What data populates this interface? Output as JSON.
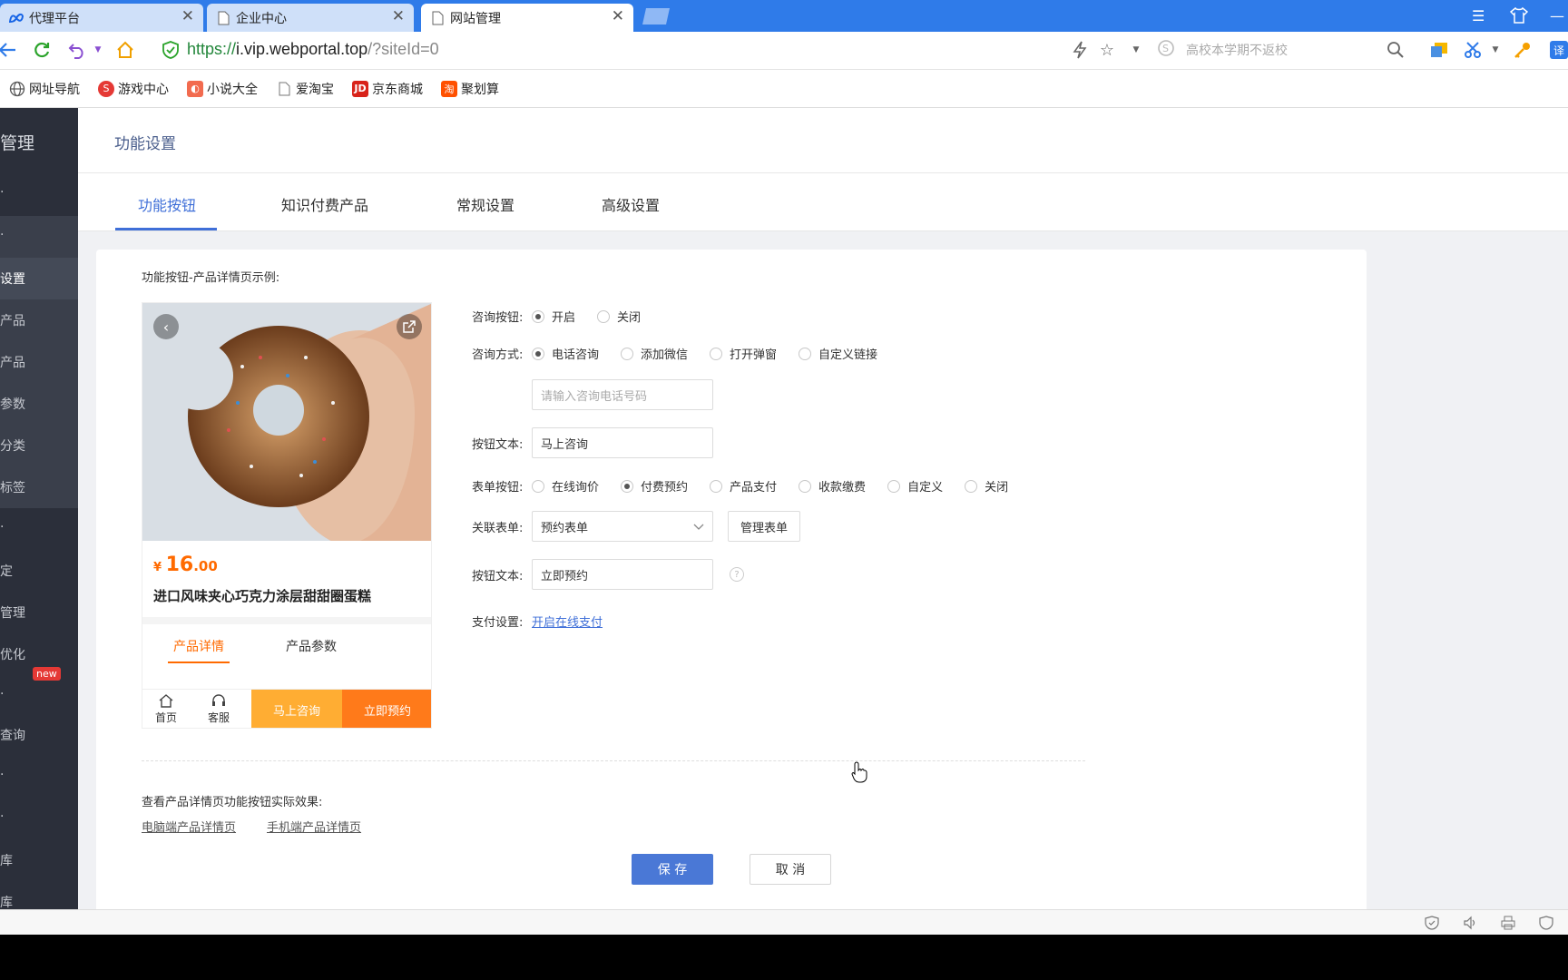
{
  "browser": {
    "tabs": [
      {
        "label": "代理平台",
        "icon": "meta-logo-icon"
      },
      {
        "label": "企业中心",
        "icon": "page-icon"
      },
      {
        "label": "网站管理",
        "icon": "page-icon"
      }
    ],
    "url_proto": "https://",
    "url_host": "i.vip.webportal.top",
    "url_path": "/?siteId=0",
    "search_placeholder": "高校本学期不返校",
    "bookmarks": [
      {
        "label": "网址导航",
        "icon": "globe-icon"
      },
      {
        "label": "游戏中心",
        "icon": "game-icon"
      },
      {
        "label": "小说大全",
        "icon": "book-icon"
      },
      {
        "label": "爱淘宝",
        "icon": "page-icon"
      },
      {
        "label": "京东商城",
        "icon": "jd-icon",
        "badge": "JD"
      },
      {
        "label": "聚划算",
        "icon": "taobao-icon",
        "badge": "淘"
      }
    ]
  },
  "sidebar": {
    "title": "管理",
    "items": [
      "·",
      "·",
      "设置",
      "产品",
      "产品",
      "参数",
      "分类",
      "标签",
      "·",
      "定",
      "管理",
      "优化",
      "·",
      "查询",
      "·",
      "·",
      "库",
      "库"
    ],
    "new_badge": "new"
  },
  "header": {
    "title": "功能设置"
  },
  "tabs": [
    "功能按钮",
    "知识付费产品",
    "常规设置",
    "高级设置"
  ],
  "card": {
    "sample_title": "功能按钮-产品详情页示例:",
    "preview": {
      "currency": "¥",
      "price_int": "16",
      "price_dec": ".00",
      "name": "进口风味夹心巧克力涂层甜甜圈蛋糕",
      "tab_detail": "产品详情",
      "tab_params": "产品参数",
      "home_label": "首页",
      "service_label": "客服",
      "consult_label": "马上咨询",
      "book_label": "立即预约"
    },
    "form": {
      "consult_button_label": "咨询按钮:",
      "consult_on": "开启",
      "consult_off": "关闭",
      "consult_method_label": "咨询方式:",
      "methods": [
        "电话咨询",
        "添加微信",
        "打开弹窗",
        "自定义链接"
      ],
      "phone_placeholder": "请输入咨询电话号码",
      "button_text_label": "按钮文本:",
      "button_text_value": "马上咨询",
      "form_button_label": "表单按钮:",
      "form_options": [
        "在线询价",
        "付费预约",
        "产品支付",
        "收款缴费",
        "自定义",
        "关闭"
      ],
      "linked_form_label": "关联表单:",
      "linked_form_value": "预约表单",
      "manage_form": "管理表单",
      "button_text2_label": "按钮文本:",
      "button_text2_value": "立即预约",
      "help_mark": "?",
      "pay_label": "支付设置:",
      "pay_link": "开启在线支付"
    },
    "effect_title": "查看产品详情页功能按钮实际效果:",
    "effect_links": [
      "电脑端产品详情页",
      "手机端产品详情页"
    ],
    "save": "保 存",
    "cancel": "取 消"
  },
  "colors": {
    "browser_blue": "#2f7be9",
    "accent": "#3f6fd8",
    "orange": "#ff7a1a",
    "sidebar": "#2b2f3a"
  }
}
